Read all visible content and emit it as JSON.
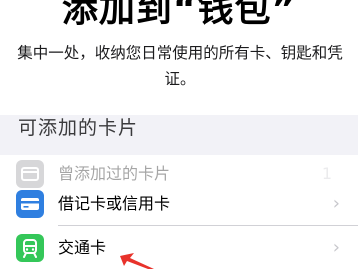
{
  "header": {
    "title": "添加到“钱包”",
    "subtitle": "集中一处，收纳您日常使用的所有卡、钥匙和凭证。"
  },
  "section": {
    "title": "可添加的卡片"
  },
  "rows": [
    {
      "label": "曾添加过的卡片",
      "count": "1",
      "icon": "wallet-icon"
    },
    {
      "label": "借记卡或信用卡",
      "icon": "credit-card-icon"
    },
    {
      "label": "交通卡",
      "icon": "train-icon"
    }
  ],
  "chevron": "›",
  "colors": {
    "previous_cards_icon": "#8e8e93",
    "credit_card_icon": "#2f7fe0",
    "transit_icon": "#34c759",
    "annotation_arrow": "#e8322b"
  }
}
